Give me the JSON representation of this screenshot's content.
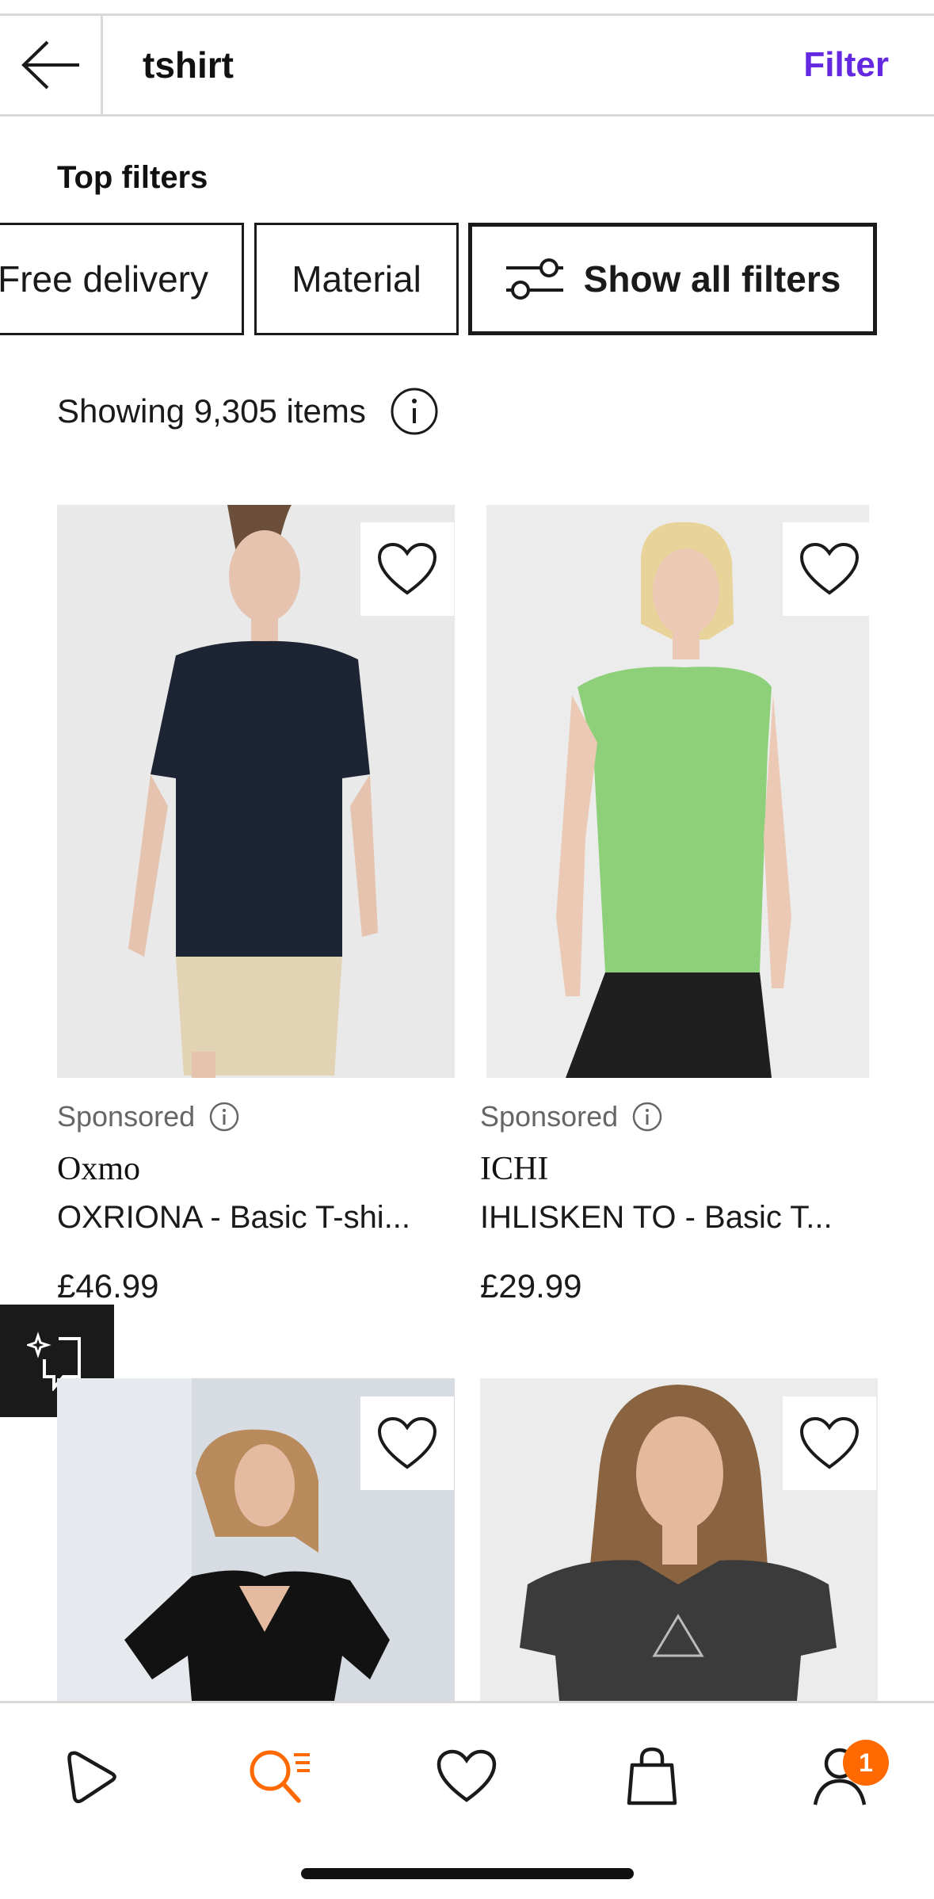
{
  "search": {
    "query": "tshirt",
    "filter_label": "Filter"
  },
  "top_filters": {
    "title": "Top filters",
    "chips": [
      "Free delivery",
      "Material",
      "Show all filters"
    ]
  },
  "results": {
    "showing_text": "Showing 9,305 items"
  },
  "products": [
    {
      "sponsored": "Sponsored",
      "brand": "Oxmo",
      "name": "OXRIONA - Basic T-shi...",
      "price": "£46.99"
    },
    {
      "sponsored": "Sponsored",
      "brand": "ICHI",
      "name": "IHLISKEN TO - Basic T...",
      "price": "£29.99"
    }
  ],
  "tabbar": {
    "account_badge": "1"
  },
  "colors": {
    "accent": "#6328e0",
    "active_tab": "#ff6900",
    "badge": "#ff6900"
  }
}
